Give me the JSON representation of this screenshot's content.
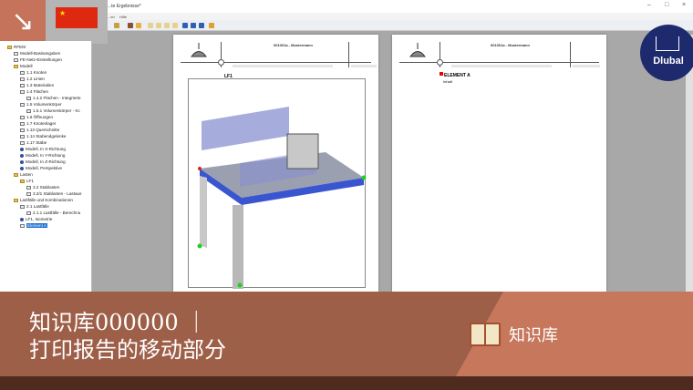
{
  "window": {
    "title": "...te Ergebnisse*",
    "menu": [
      "...en",
      "Hilfe"
    ],
    "controls": [
      "–",
      "□",
      "×"
    ]
  },
  "overlay": {
    "flag_icon": "china-flag",
    "arrow_icon": "arrow-down-right"
  },
  "tree": [
    {
      "label": "RFEM",
      "lvl": 0,
      "icon": "folder"
    },
    {
      "label": "Modell-Basisangaben",
      "lvl": 1,
      "icon": "table"
    },
    {
      "label": "FE-Netz-Einstellungen",
      "lvl": 1,
      "icon": "table"
    },
    {
      "label": "Modell",
      "lvl": 1,
      "icon": "folder"
    },
    {
      "label": "1.1 Knoten",
      "lvl": 2,
      "icon": "table"
    },
    {
      "label": "1.2 Linien",
      "lvl": 2,
      "icon": "table"
    },
    {
      "label": "1.3 Materialien",
      "lvl": 2,
      "icon": "table"
    },
    {
      "label": "1.4 Flächen",
      "lvl": 2,
      "icon": "table"
    },
    {
      "label": "1.4.2 Flächen - Integrierte",
      "lvl": 3,
      "icon": "table"
    },
    {
      "label": "1.5 Volumenkörper",
      "lvl": 2,
      "icon": "table"
    },
    {
      "label": "1.5.1 Volumenkörper - Kc",
      "lvl": 3,
      "icon": "table"
    },
    {
      "label": "1.6 Öffnungen",
      "lvl": 2,
      "icon": "table"
    },
    {
      "label": "1.7 Knotenlager",
      "lvl": 2,
      "icon": "table"
    },
    {
      "label": "1.13 Querschnitte",
      "lvl": 2,
      "icon": "table"
    },
    {
      "label": "1.14 Stabendgelenke",
      "lvl": 2,
      "icon": "table"
    },
    {
      "label": "1.17 Stäbe",
      "lvl": 2,
      "icon": "table"
    },
    {
      "label": "Modell, In X-Richtung",
      "lvl": 2,
      "icon": "model"
    },
    {
      "label": "Modell, In Y-Richtung",
      "lvl": 2,
      "icon": "model"
    },
    {
      "label": "Modell, In Z-Richtung",
      "lvl": 2,
      "icon": "model"
    },
    {
      "label": "Modell, Perspektive",
      "lvl": 2,
      "icon": "model"
    },
    {
      "label": "Lasten",
      "lvl": 1,
      "icon": "folder"
    },
    {
      "label": "LF1",
      "lvl": 2,
      "icon": "folder"
    },
    {
      "label": "3.2 Stablasten",
      "lvl": 3,
      "icon": "table"
    },
    {
      "label": "3.2/1 Stablasten - Lastaus",
      "lvl": 3,
      "icon": "table"
    },
    {
      "label": "Lastfälle und Kombinationen",
      "lvl": 1,
      "icon": "folder"
    },
    {
      "label": "2.1 Lastfälle",
      "lvl": 2,
      "icon": "table"
    },
    {
      "label": "2.1.1 Lastfälle - Berechnu",
      "lvl": 3,
      "icon": "table"
    },
    {
      "label": "LF1, Isometrie",
      "lvl": 2,
      "icon": "model"
    },
    {
      "label": "Element A",
      "lvl": 2,
      "icon": "table",
      "selected": true
    }
  ],
  "page1": {
    "project": "001001a - Mustermann",
    "section": "LF1"
  },
  "page2": {
    "project": "001001a - Mustermann",
    "section": "ELEMENT A",
    "sub": "Inhalt"
  },
  "brand": {
    "name": "Dlubal"
  },
  "banner": {
    "line1": "知识库000000 ｜",
    "line2": "打印报告的移动部分",
    "tag": "知识库"
  }
}
